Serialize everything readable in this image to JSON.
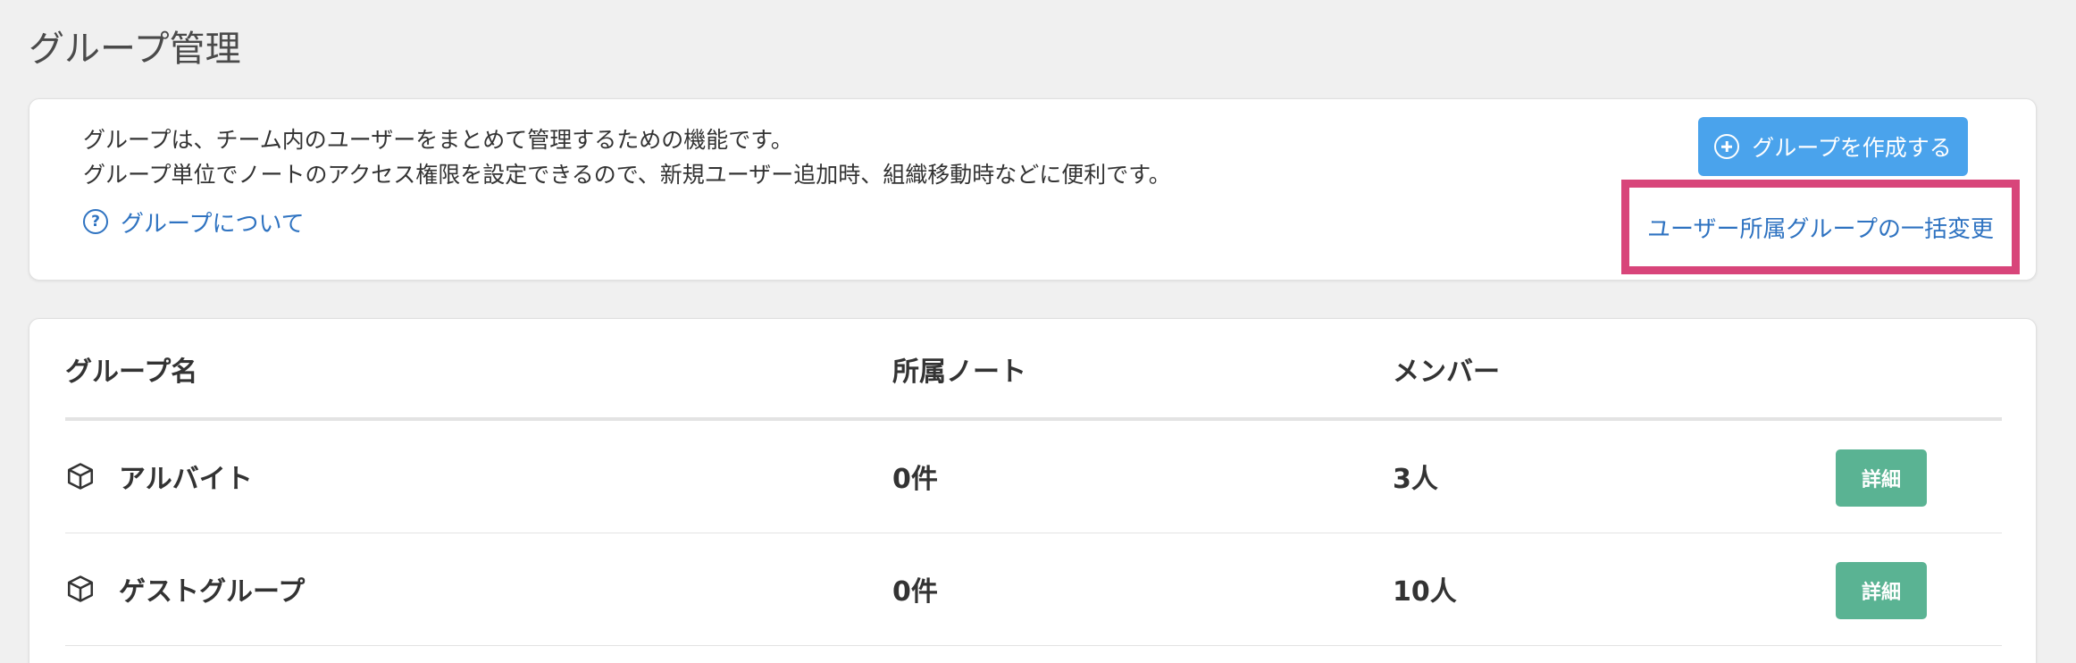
{
  "page": {
    "title": "グループ管理"
  },
  "info": {
    "line1": "グループは、チーム内のユーザーをまとめて管理するための機能です。",
    "line2": "グループ単位でノートのアクセス権限を設定できるので、新規ユーザー追加時、組織移動時などに便利です。",
    "about_link": "グループについて",
    "create_button": "グループを作成する",
    "bulk_change_link": "ユーザー所属グループの一括変更",
    "highlight_color": "#d8457a",
    "accent_color": "#4aa3ec",
    "link_color": "#2f73c1"
  },
  "table": {
    "headers": {
      "name": "グループ名",
      "notes": "所属ノート",
      "members": "メンバー"
    },
    "rows": [
      {
        "name": "アルバイト",
        "notes": "0件",
        "members": "3人",
        "action": "詳細"
      },
      {
        "name": "ゲストグループ",
        "notes": "0件",
        "members": "10人",
        "action": "詳細"
      }
    ],
    "action_color": "#5ab393"
  },
  "icons": {
    "help": "question-circle-icon",
    "create": "plus-circle-icon",
    "group": "cube-icon"
  }
}
